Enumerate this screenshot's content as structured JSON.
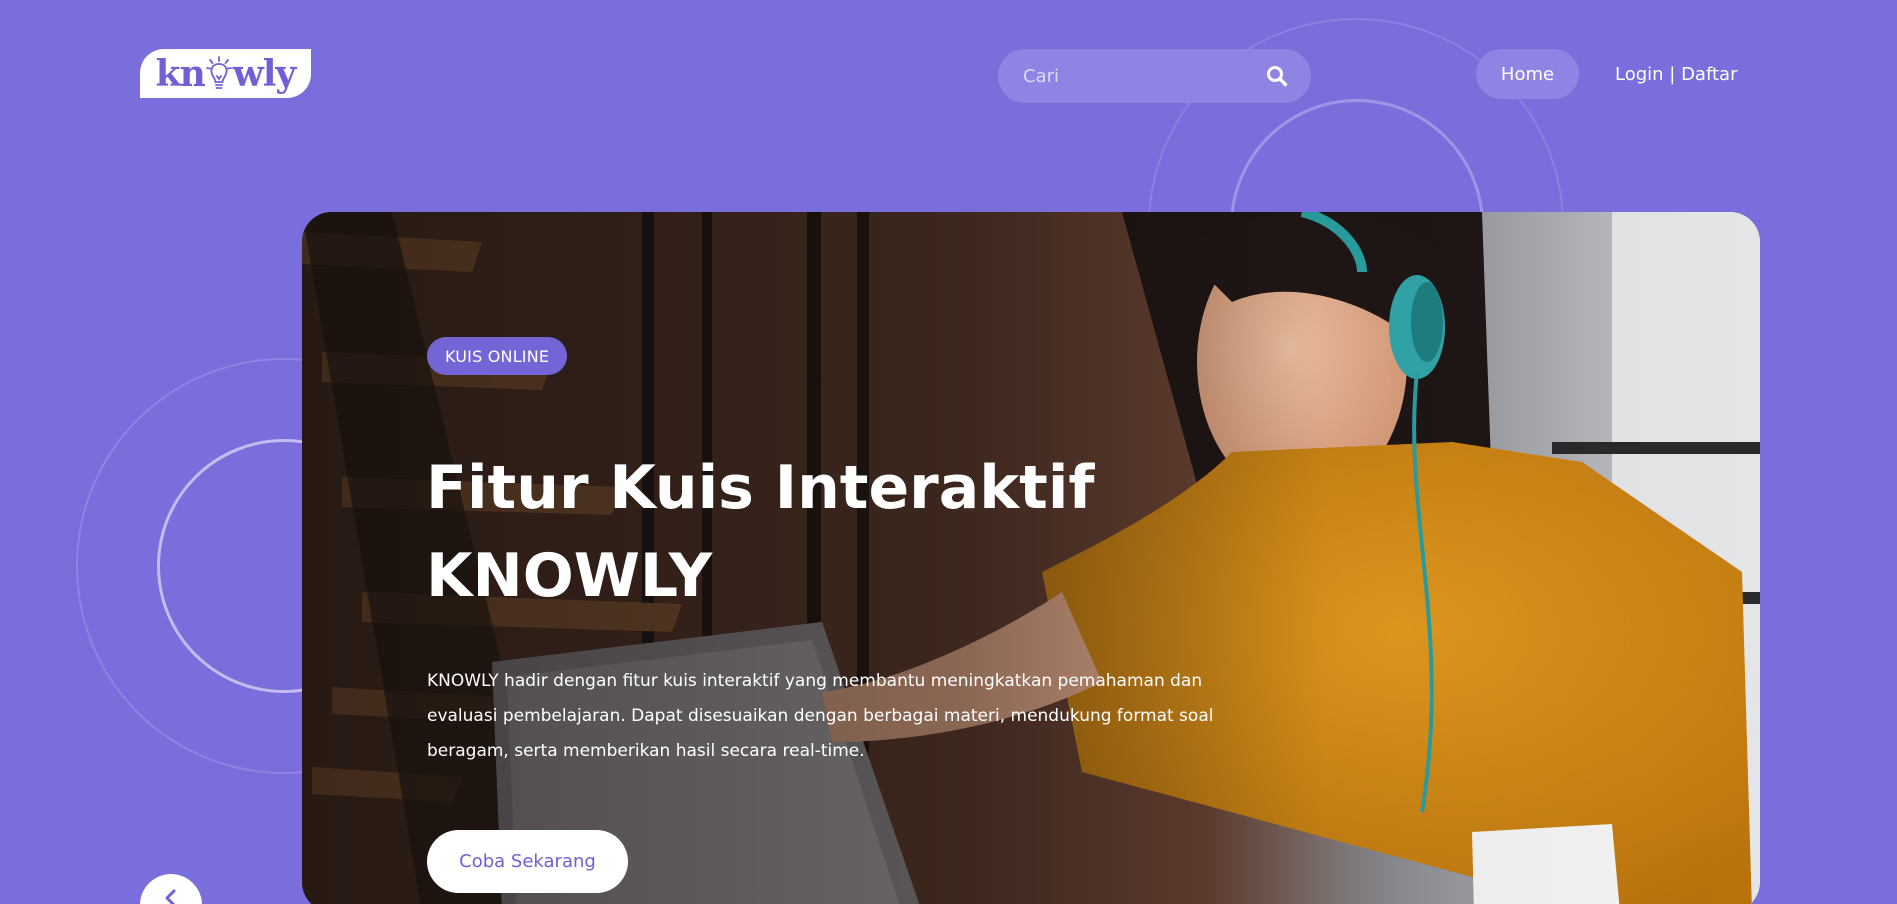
{
  "header": {
    "logo_text_left": "kn",
    "logo_text_right": "wly",
    "search": {
      "placeholder": "Cari",
      "icon": "search-icon"
    },
    "nav": {
      "home_label": "Home",
      "auth_label": "Login | Daftar"
    }
  },
  "hero": {
    "badge": "KUIS ONLINE",
    "title_line1": "Fitur Kuis Interaktif",
    "title_line2": "KNOWLY",
    "description": "KNOWLY hadir dengan fitur kuis interaktif yang membantu meningkatkan pemahaman dan evaluasi pembelajaran. Dapat disesuaikan dengan berbagai materi, mendukung format soal beragam, serta memberikan hasil secara real-time.",
    "cta_label": "Coba Sekarang",
    "image_icon": "woman-with-headphones-laptop-photo"
  },
  "carousel": {
    "prev_icon": "chevron-left-icon"
  },
  "colors": {
    "background": "#7a6ddc",
    "accent": "#6f60d6",
    "badge": "#7465d6",
    "search_bg": "#8f84e3",
    "white": "#ffffff"
  }
}
